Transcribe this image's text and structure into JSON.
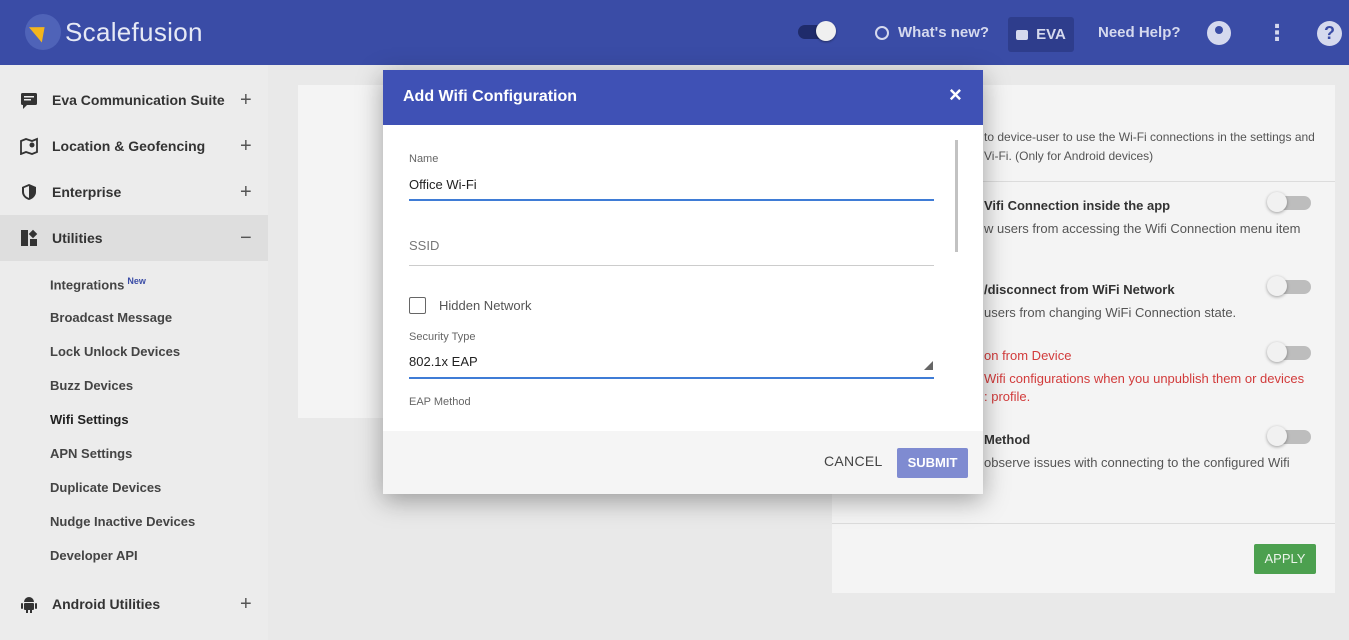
{
  "header": {
    "logo_text": "Scalefusion",
    "whats_new": "What's new?",
    "eva": "EVA",
    "need_help": "Need Help?"
  },
  "sidebar": {
    "items": [
      {
        "label": "Eva Communication Suite",
        "icon": "chat-icon",
        "state": "+"
      },
      {
        "label": "Location & Geofencing",
        "icon": "map-pin-icon",
        "state": "+"
      },
      {
        "label": "Enterprise",
        "icon": "shield-icon",
        "state": "+"
      },
      {
        "label": "Utilities",
        "icon": "widgets-icon",
        "state": "−"
      },
      {
        "label": "Android Utilities",
        "icon": "android-icon",
        "state": "+"
      }
    ],
    "sub_items": [
      {
        "label": "Integrations",
        "badge": "New"
      },
      {
        "label": "Broadcast Message"
      },
      {
        "label": "Lock Unlock Devices"
      },
      {
        "label": "Buzz Devices"
      },
      {
        "label": "Wifi Settings"
      },
      {
        "label": "APN Settings"
      },
      {
        "label": "Duplicate Devices"
      },
      {
        "label": "Nudge Inactive Devices"
      },
      {
        "label": "Developer API"
      }
    ]
  },
  "right_panel": {
    "intro_line1": "to device-user to use the Wi-Fi connections in the settings and",
    "intro_line2": "Vi-Fi. (Only for Android devices)",
    "opt1_title": "Vifi Connection inside the app",
    "opt1_desc": "w users from accessing the Wifi Connection menu item",
    "opt2_title": "/disconnect from WiFi Network",
    "opt2_desc": "users from changing WiFi Connection state.",
    "opt3_title": "on from Device",
    "opt3_desc1": "Wifi configurations when you unpublish them or devices",
    "opt3_desc2": ": profile.",
    "opt4_title": "Method",
    "opt4_desc": "observe issues with connecting to the configured Wifi",
    "apply": "APPLY"
  },
  "modal": {
    "title": "Add Wifi Configuration",
    "close": "×",
    "name_label": "Name",
    "name_value": "Office Wi-Fi",
    "ssid_placeholder": "SSID",
    "hidden_network": "Hidden Network",
    "security_label": "Security Type",
    "security_value": "802.1x EAP",
    "eap_label": "EAP Method",
    "cancel": "CANCEL",
    "submit": "SUBMIT"
  },
  "colors": {
    "header": "#3a4ca6",
    "modal_header": "#3f51b5",
    "submit": "#7f8bd1",
    "apply": "#4ca04f",
    "active_underline": "#3f7cd6",
    "warning_text": "#d23b3b"
  }
}
